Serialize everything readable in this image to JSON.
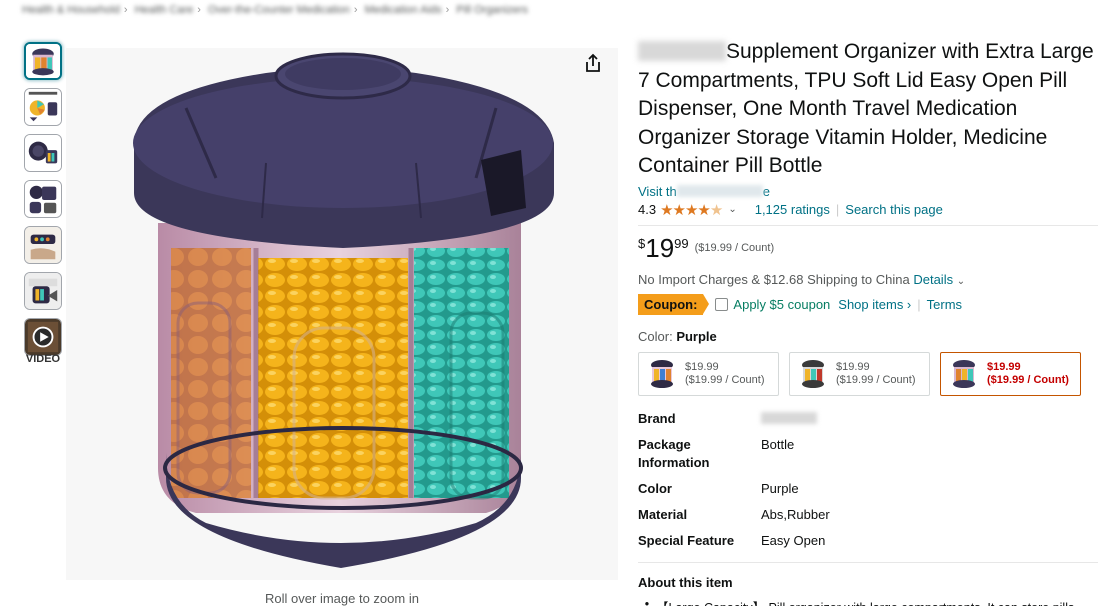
{
  "breadcrumb": [
    "Health & Household",
    "Health Care",
    "Over-the-Counter Medication",
    "Medication Aids",
    "Pill Organizers"
  ],
  "thumbnails": [
    {
      "name": "thumb-main",
      "active": true
    },
    {
      "name": "thumb-info",
      "active": false
    },
    {
      "name": "thumb-open",
      "active": false
    },
    {
      "name": "thumb-lifestyle",
      "active": false
    },
    {
      "name": "thumb-hand",
      "active": false
    },
    {
      "name": "thumb-travel",
      "active": false
    },
    {
      "name": "thumb-dark",
      "active": false
    },
    {
      "name": "thumb-video",
      "active": false
    }
  ],
  "video_label": "VIDEO",
  "zoom_hint": "Roll over image to zoom in",
  "product": {
    "title": "Supplement Organizer with Extra Large 7 Compartments, TPU Soft Lid Easy Open Pill Dispenser, One Month Travel Medication Organizer Storage Vitamin Holder, Medicine Container Pill Bottle",
    "store_prefix": "Visit th",
    "store_suffix": "e",
    "rating": "4.3",
    "ratings_count": "1,125 ratings",
    "search_page": "Search this page",
    "price_symbol": "$",
    "price_whole": "19",
    "price_fraction": "99",
    "price_unit": "($19.99 / Count)",
    "shipping_text": "No Import Charges & $12.68 Shipping to China",
    "shipping_link": "Details",
    "coupon_badge": "Coupon:",
    "coupon_text": "Apply $5 coupon",
    "coupon_shop": "Shop items ›",
    "coupon_terms": "Terms",
    "color_label": "Color:",
    "color_value": "Purple"
  },
  "variants": [
    {
      "price": "$19.99",
      "unit": "($19.99 / Count)",
      "selected": false
    },
    {
      "price": "$19.99",
      "unit": "($19.99 / Count)",
      "selected": false
    },
    {
      "price": "$19.99",
      "unit": "($19.99 / Count)",
      "selected": true
    }
  ],
  "specs": [
    {
      "key": "Brand",
      "value": ""
    },
    {
      "key": "Package Information",
      "value": "Bottle"
    },
    {
      "key": "Color",
      "value": "Purple"
    },
    {
      "key": "Material",
      "value": "Abs,Rubber"
    },
    {
      "key": "Special Feature",
      "value": "Easy Open"
    }
  ],
  "about": {
    "title": "About this item",
    "items": [
      "【Large Capacity】 Pill organizer with large compartments. It can store pills"
    ]
  },
  "colors": {
    "link": "#007185",
    "star": "#de7921",
    "coupon": "#f49d1a",
    "lid": "#3b3759",
    "selected_border": "#c45500",
    "selected_text": "#c40000"
  }
}
